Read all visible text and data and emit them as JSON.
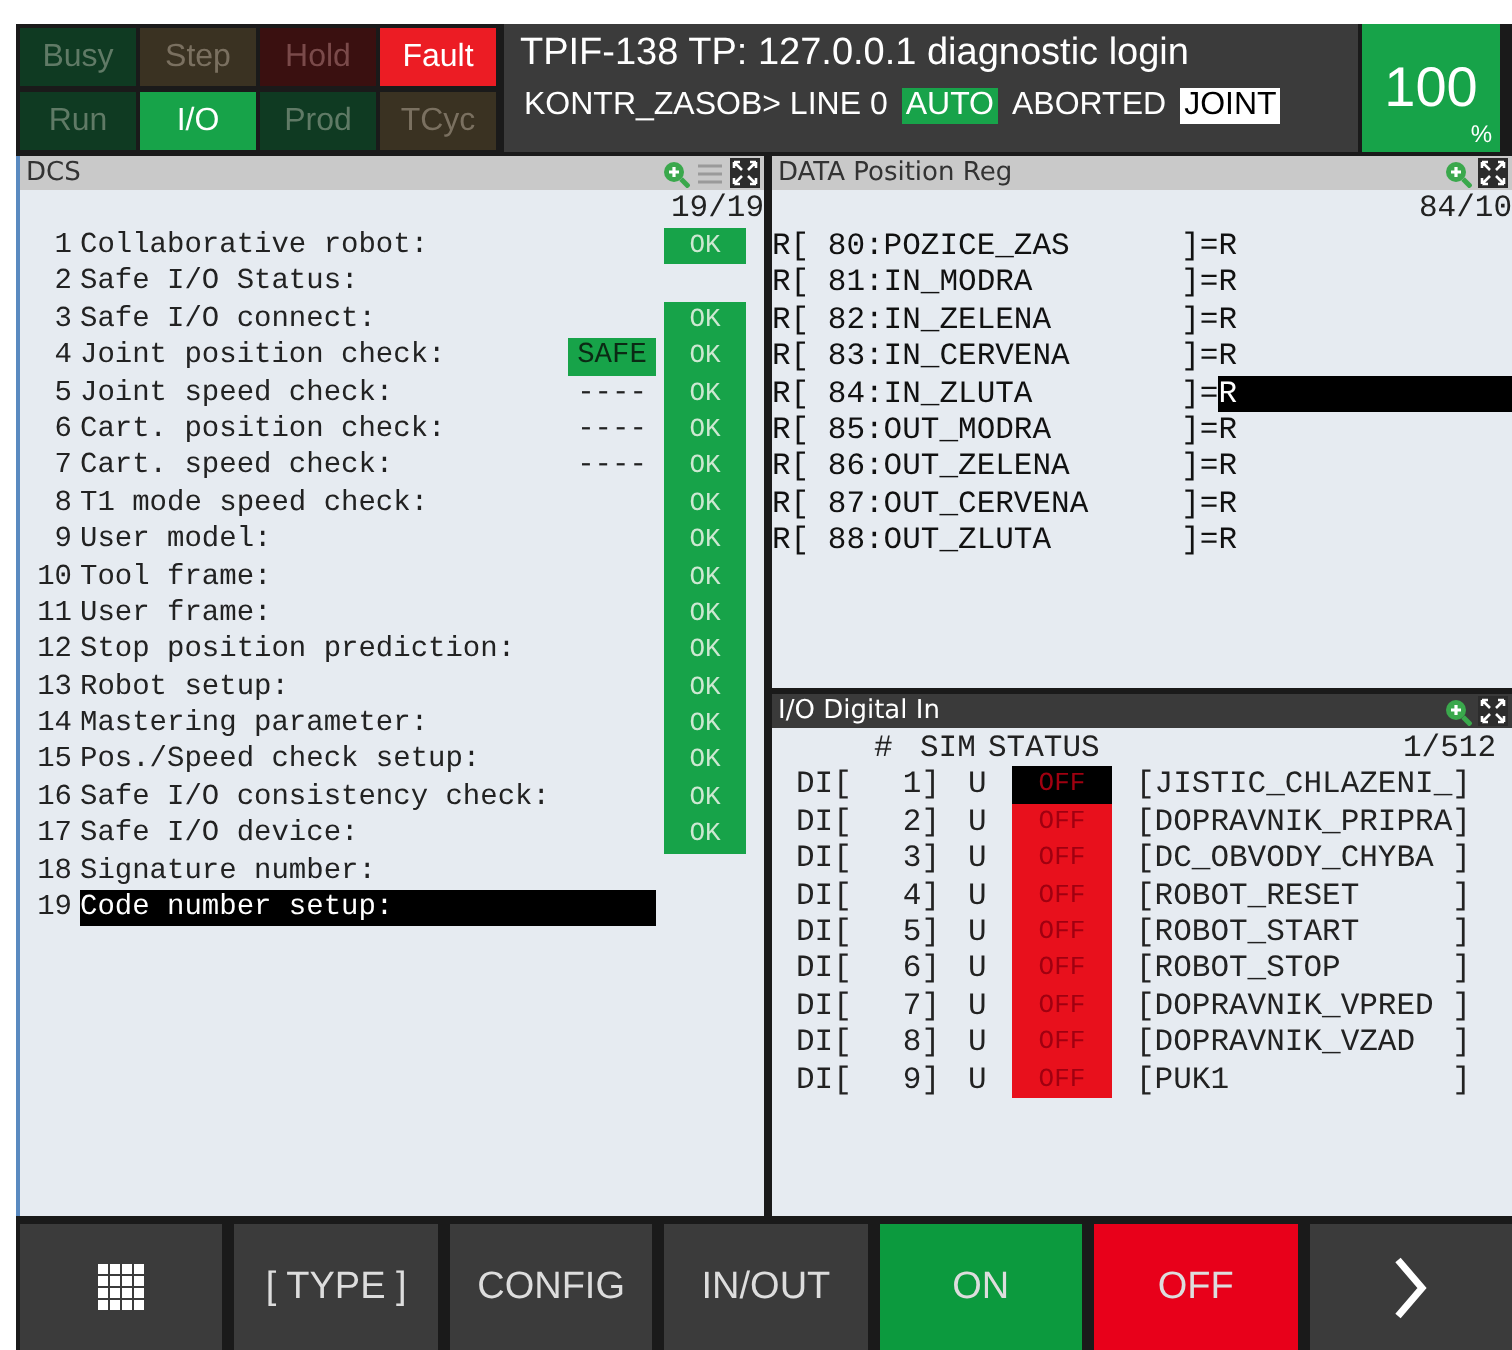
{
  "status_lamps": [
    {
      "label": "Busy",
      "kind": "green",
      "on": false
    },
    {
      "label": "Step",
      "kind": "amber",
      "on": false
    },
    {
      "label": "Hold",
      "kind": "red",
      "on": false
    },
    {
      "label": "Fault",
      "kind": "red",
      "on": true
    },
    {
      "label": "Run",
      "kind": "green",
      "on": false
    },
    {
      "label": "I/O",
      "kind": "green",
      "on": true
    },
    {
      "label": "Prod",
      "kind": "green",
      "on": false
    },
    {
      "label": "TCyc",
      "kind": "amber",
      "on": false
    }
  ],
  "title_bar": {
    "line1": "TPIF-138 TP: 127.0.0.1 diagnostic login",
    "line2": [
      {
        "text": "KONTR_ZASOB> LINE 0",
        "kind": "plain"
      },
      {
        "text": "AUTO",
        "kind": "green"
      },
      {
        "text": "ABORTED",
        "kind": "plain"
      },
      {
        "text": "JOINT",
        "kind": "white"
      }
    ]
  },
  "override": {
    "value": "100",
    "unit": "%"
  },
  "dcs_panel": {
    "title": "DCS",
    "focused": false,
    "count": "19/19",
    "rows": [
      {
        "number": "1",
        "label": "Collaborative robot:",
        "status": "OK",
        "selected": false
      },
      {
        "number": "2",
        "label": "Safe I/O Status:",
        "selected": false
      },
      {
        "number": "3",
        "label": "Safe I/O connect:",
        "status": "OK",
        "selected": false
      },
      {
        "number": "4",
        "label": "Joint position check:",
        "value": {
          "text": "SAFE",
          "highlight": true
        },
        "status": "OK",
        "selected": false
      },
      {
        "number": "5",
        "label": "Joint speed check:",
        "value": {
          "text": "----",
          "highlight": false
        },
        "status": "OK",
        "selected": false
      },
      {
        "number": "6",
        "label": "Cart. position check:",
        "value": {
          "text": "----",
          "highlight": false
        },
        "status": "OK",
        "selected": false
      },
      {
        "number": "7",
        "label": "Cart. speed check:",
        "value": {
          "text": "----",
          "highlight": false
        },
        "status": "OK",
        "selected": false
      },
      {
        "number": "8",
        "label": "T1 mode speed check:",
        "status": "OK",
        "selected": false
      },
      {
        "number": "9",
        "label": "User model:",
        "status": "OK",
        "selected": false
      },
      {
        "number": "10",
        "label": "Tool frame:",
        "status": "OK",
        "selected": false
      },
      {
        "number": "11",
        "label": "User frame:",
        "status": "OK",
        "selected": false
      },
      {
        "number": "12",
        "label": "Stop position prediction:",
        "status": "OK",
        "selected": false
      },
      {
        "number": "13",
        "label": "Robot setup:",
        "status": "OK",
        "selected": false
      },
      {
        "number": "14",
        "label": "Mastering parameter:",
        "status": "OK",
        "selected": false
      },
      {
        "number": "15",
        "label": "Pos./Speed check setup:",
        "status": "OK",
        "selected": false
      },
      {
        "number": "16",
        "label": "Safe I/O consistency check:",
        "status": "OK",
        "selected": false
      },
      {
        "number": "17",
        "label": "Safe I/O device:",
        "status": "OK",
        "selected": false
      },
      {
        "number": "18",
        "label": "Signature number:",
        "selected": false
      },
      {
        "number": "19",
        "label": "Code number setup:",
        "selected": true
      }
    ]
  },
  "data_panel": {
    "title": "DATA Position Reg",
    "focused": false,
    "count": "84/10",
    "rows": [
      {
        "register": "R[ 80:POZICE_ZAS      ]=",
        "value": "R",
        "selected": false
      },
      {
        "register": "R[ 81:IN_MODRA        ]=",
        "value": "R",
        "selected": false
      },
      {
        "register": "R[ 82:IN_ZELENA       ]=",
        "value": "R",
        "selected": false
      },
      {
        "register": "R[ 83:IN_CERVENA      ]=",
        "value": "R",
        "selected": false
      },
      {
        "register": "R[ 84:IN_ZLUTA        ]=",
        "value": "R",
        "selected": true
      },
      {
        "register": "R[ 85:OUT_MODRA       ]=",
        "value": "R",
        "selected": false
      },
      {
        "register": "R[ 86:OUT_ZELENA      ]=",
        "value": "R",
        "selected": false
      },
      {
        "register": "R[ 87:OUT_CERVENA     ]=",
        "value": "R",
        "selected": false
      },
      {
        "register": "R[ 88:OUT_ZLUTA       ]=",
        "value": "R",
        "selected": false
      }
    ]
  },
  "io_panel": {
    "title": "I/O Digital In",
    "focused": true,
    "columns": [
      "#",
      "SIM",
      "STATUS"
    ],
    "count": "1/512",
    "rows": [
      {
        "port": "DI[",
        "index": "1]",
        "sim": "U",
        "status": "OFF",
        "on": false,
        "comment": "[JISTIC_CHLAZENI_]",
        "selected": true
      },
      {
        "port": "DI[",
        "index": "2]",
        "sim": "U",
        "status": "OFF",
        "on": false,
        "comment": "[DOPRAVNIK_PRIPRA]",
        "selected": false
      },
      {
        "port": "DI[",
        "index": "3]",
        "sim": "U",
        "status": "OFF",
        "on": false,
        "comment": "[DC_OBVODY_CHYBA ]",
        "selected": false
      },
      {
        "port": "DI[",
        "index": "4]",
        "sim": "U",
        "status": "OFF",
        "on": false,
        "comment": "[ROBOT_RESET     ]",
        "selected": false
      },
      {
        "port": "DI[",
        "index": "5]",
        "sim": "U",
        "status": "OFF",
        "on": false,
        "comment": "[ROBOT_START     ]",
        "selected": false
      },
      {
        "port": "DI[",
        "index": "6]",
        "sim": "U",
        "status": "OFF",
        "on": false,
        "comment": "[ROBOT_STOP      ]",
        "selected": false
      },
      {
        "port": "DI[",
        "index": "7]",
        "sim": "U",
        "status": "OFF",
        "on": false,
        "comment": "[DOPRAVNIK_VPRED ]",
        "selected": false
      },
      {
        "port": "DI[",
        "index": "8]",
        "sim": "U",
        "status": "OFF",
        "on": false,
        "comment": "[DOPRAVNIK_VZAD  ]",
        "selected": false
      },
      {
        "port": "DI[",
        "index": "9]",
        "sim": "U",
        "status": "OFF",
        "on": false,
        "comment": "[PUK1            ]",
        "selected": false
      }
    ]
  },
  "function_keys": [
    {
      "kind": "menu"
    },
    {
      "label": "[ TYPE ]",
      "kind": "plain"
    },
    {
      "label": "CONFIG",
      "kind": "plain"
    },
    {
      "label": "IN/OUT",
      "kind": "plain"
    },
    {
      "label": "ON",
      "kind": "green"
    },
    {
      "label": "OFF",
      "kind": "red"
    },
    {
      "kind": "next"
    }
  ]
}
